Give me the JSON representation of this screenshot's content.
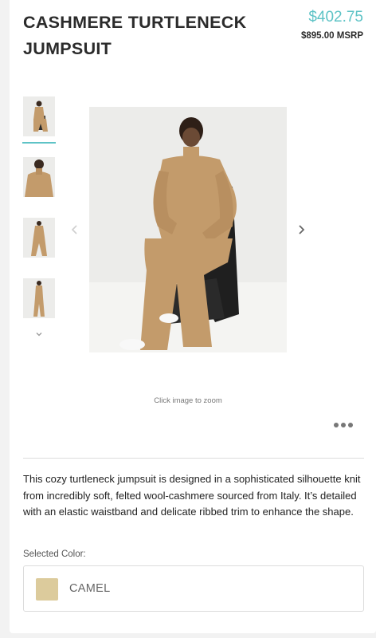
{
  "product": {
    "title": "CASHMERE TURTLENECK JUMPSUIT",
    "price": "$402.75",
    "msrp": "$895.00 MSRP"
  },
  "gallery": {
    "thumbnails": [
      {
        "icon": "product-thumbnail-seated"
      },
      {
        "icon": "product-thumbnail-closeup"
      },
      {
        "icon": "product-thumbnail-standing-front"
      },
      {
        "icon": "product-thumbnail-standing-side"
      }
    ],
    "zoom_hint": "Click image to zoom"
  },
  "description": "This cozy turtleneck jumpsuit is designed in a sophisticated silhouette knit from incredibly soft, felted wool-cashmere sourced from Italy. It’s detailed with an elastic waistband and delicate ribbed trim to enhance the shape.",
  "color": {
    "label": "Selected Color:",
    "selected": "CAMEL",
    "swatch_hex": "#dccb9c"
  },
  "colors": {
    "accent": "#5ec3c6",
    "camel": "#c39b6b"
  }
}
